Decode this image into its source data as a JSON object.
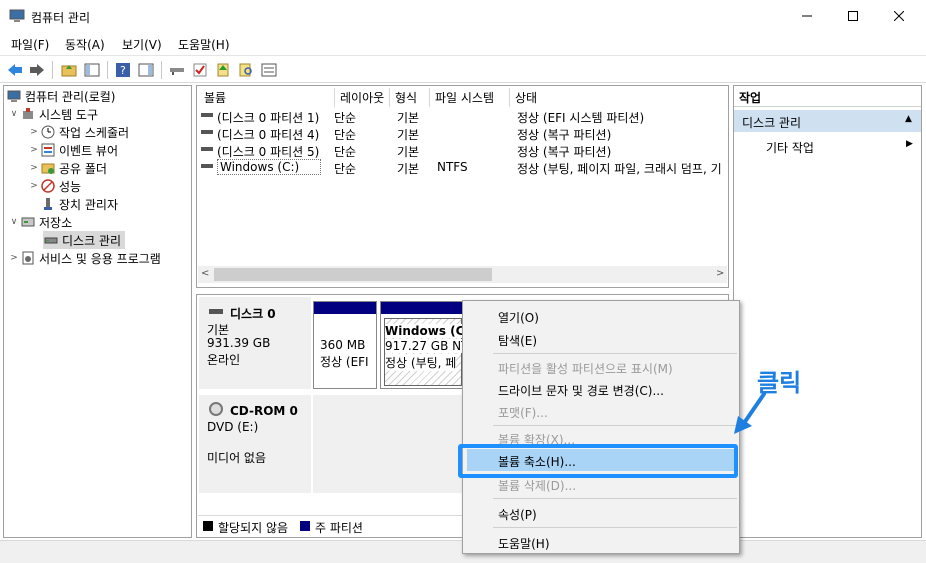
{
  "window": {
    "title": "컴퓨터 관리",
    "icon": "computer-management-icon"
  },
  "menu": {
    "items": [
      "파일(F)",
      "동작(A)",
      "보기(V)",
      "도움말(H)"
    ]
  },
  "tree": {
    "root": "컴퓨터 관리(로컬)",
    "system_tools": "시스템 도구",
    "task_scheduler": "작업 스케줄러",
    "event_viewer": "이벤트 뷰어",
    "shared_folders": "공유 폴더",
    "performance": "성능",
    "device_manager": "장치 관리자",
    "storage": "저장소",
    "disk_management": "디스크 관리",
    "services": "서비스 및 응용 프로그램"
  },
  "volumes": {
    "headers": [
      "볼륨",
      "레이아웃",
      "형식",
      "파일 시스템",
      "상태"
    ],
    "rows": [
      {
        "volume": "(디스크 0 파티션 1)",
        "layout": "단순",
        "type": "기본",
        "fs": "",
        "status": "정상 (EFI 시스템 파티션)"
      },
      {
        "volume": "(디스크 0 파티션 4)",
        "layout": "단순",
        "type": "기본",
        "fs": "",
        "status": "정상 (복구 파티션)"
      },
      {
        "volume": "(디스크 0 파티션 5)",
        "layout": "단순",
        "type": "기본",
        "fs": "",
        "status": "정상 (복구 파티션)"
      },
      {
        "volume": "Windows (C:)",
        "layout": "단순",
        "type": "기본",
        "fs": "NTFS",
        "status": "정상 (부팅, 페이지 파일, 크래시 덤프, 기"
      }
    ]
  },
  "disks": {
    "disk0": {
      "name": "디스크 0",
      "type": "기본",
      "size": "931.39 GB",
      "state": "온라인",
      "part1_size": "360 MB",
      "part1_status": "정상 (EFI",
      "part2_name": "Windows (C:",
      "part2_size": "917.27 GB NT",
      "part2_status": "정상 (부팅, 페"
    },
    "cdrom": {
      "name": "CD-ROM 0",
      "drive": "DVD (E:)",
      "media": "미디어 없음"
    }
  },
  "legend": {
    "unallocated": "할당되지 않음",
    "primary": "주 파티션"
  },
  "actions": {
    "header": "작업",
    "section": "디스크 관리",
    "more": "기타 작업"
  },
  "context_menu": {
    "open": "열기(O)",
    "explore": "탐색(E)",
    "mark_active": "파티션을 활성 파티션으로 표시(M)",
    "change_letter": "드라이브 문자 및 경로 변경(C)...",
    "format": "포맷(F)...",
    "extend": "볼륨 확장(X)...",
    "shrink": "볼륨 축소(H)...",
    "delete": "볼륨 삭제(D)...",
    "properties": "속성(P)",
    "help": "도움말(H)"
  },
  "annotation": {
    "text": "클릭"
  },
  "colors": {
    "highlight": "#1e90ff",
    "partition_bar": "#000080",
    "actions_header": "#cfe0f1"
  }
}
